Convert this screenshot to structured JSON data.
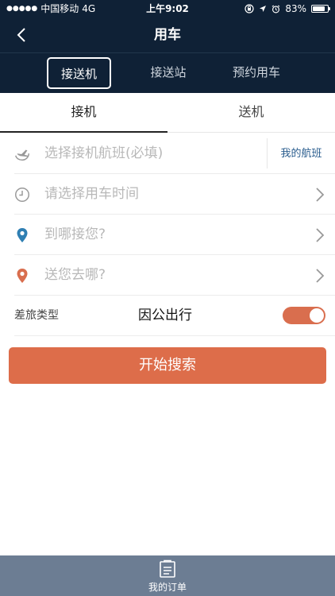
{
  "status_bar": {
    "carrier": "中国移动",
    "network": "4G",
    "time": "上午9:02",
    "battery": "83%",
    "battery_level": 0.83
  },
  "nav": {
    "title": "用车"
  },
  "mode_tabs": [
    {
      "label": "接送机",
      "active": true
    },
    {
      "label": "接送站",
      "active": false
    },
    {
      "label": "预约用车",
      "active": false
    }
  ],
  "sub_tabs": [
    {
      "label": "接机",
      "active": true
    },
    {
      "label": "送机",
      "active": false
    }
  ],
  "form": {
    "flight_placeholder": "选择接机航班(必填)",
    "my_flight_label": "我的航班",
    "time_placeholder": "请选择用车时间",
    "pickup_placeholder": "到哪接您?",
    "dropoff_placeholder": "送您去哪?",
    "travel_type_label": "差旅类型",
    "travel_type_value": "因公出行",
    "travel_toggle_on": true
  },
  "search_button": "开始搜索",
  "bottom_bar": {
    "orders_label": "我的订单"
  },
  "colors": {
    "header_bg": "#0f2136",
    "accent": "#dd6d4a",
    "pickup_pin": "#2f7fb3",
    "dropoff_pin": "#d96e4e",
    "bottom_bar_bg": "#6c7d93"
  }
}
